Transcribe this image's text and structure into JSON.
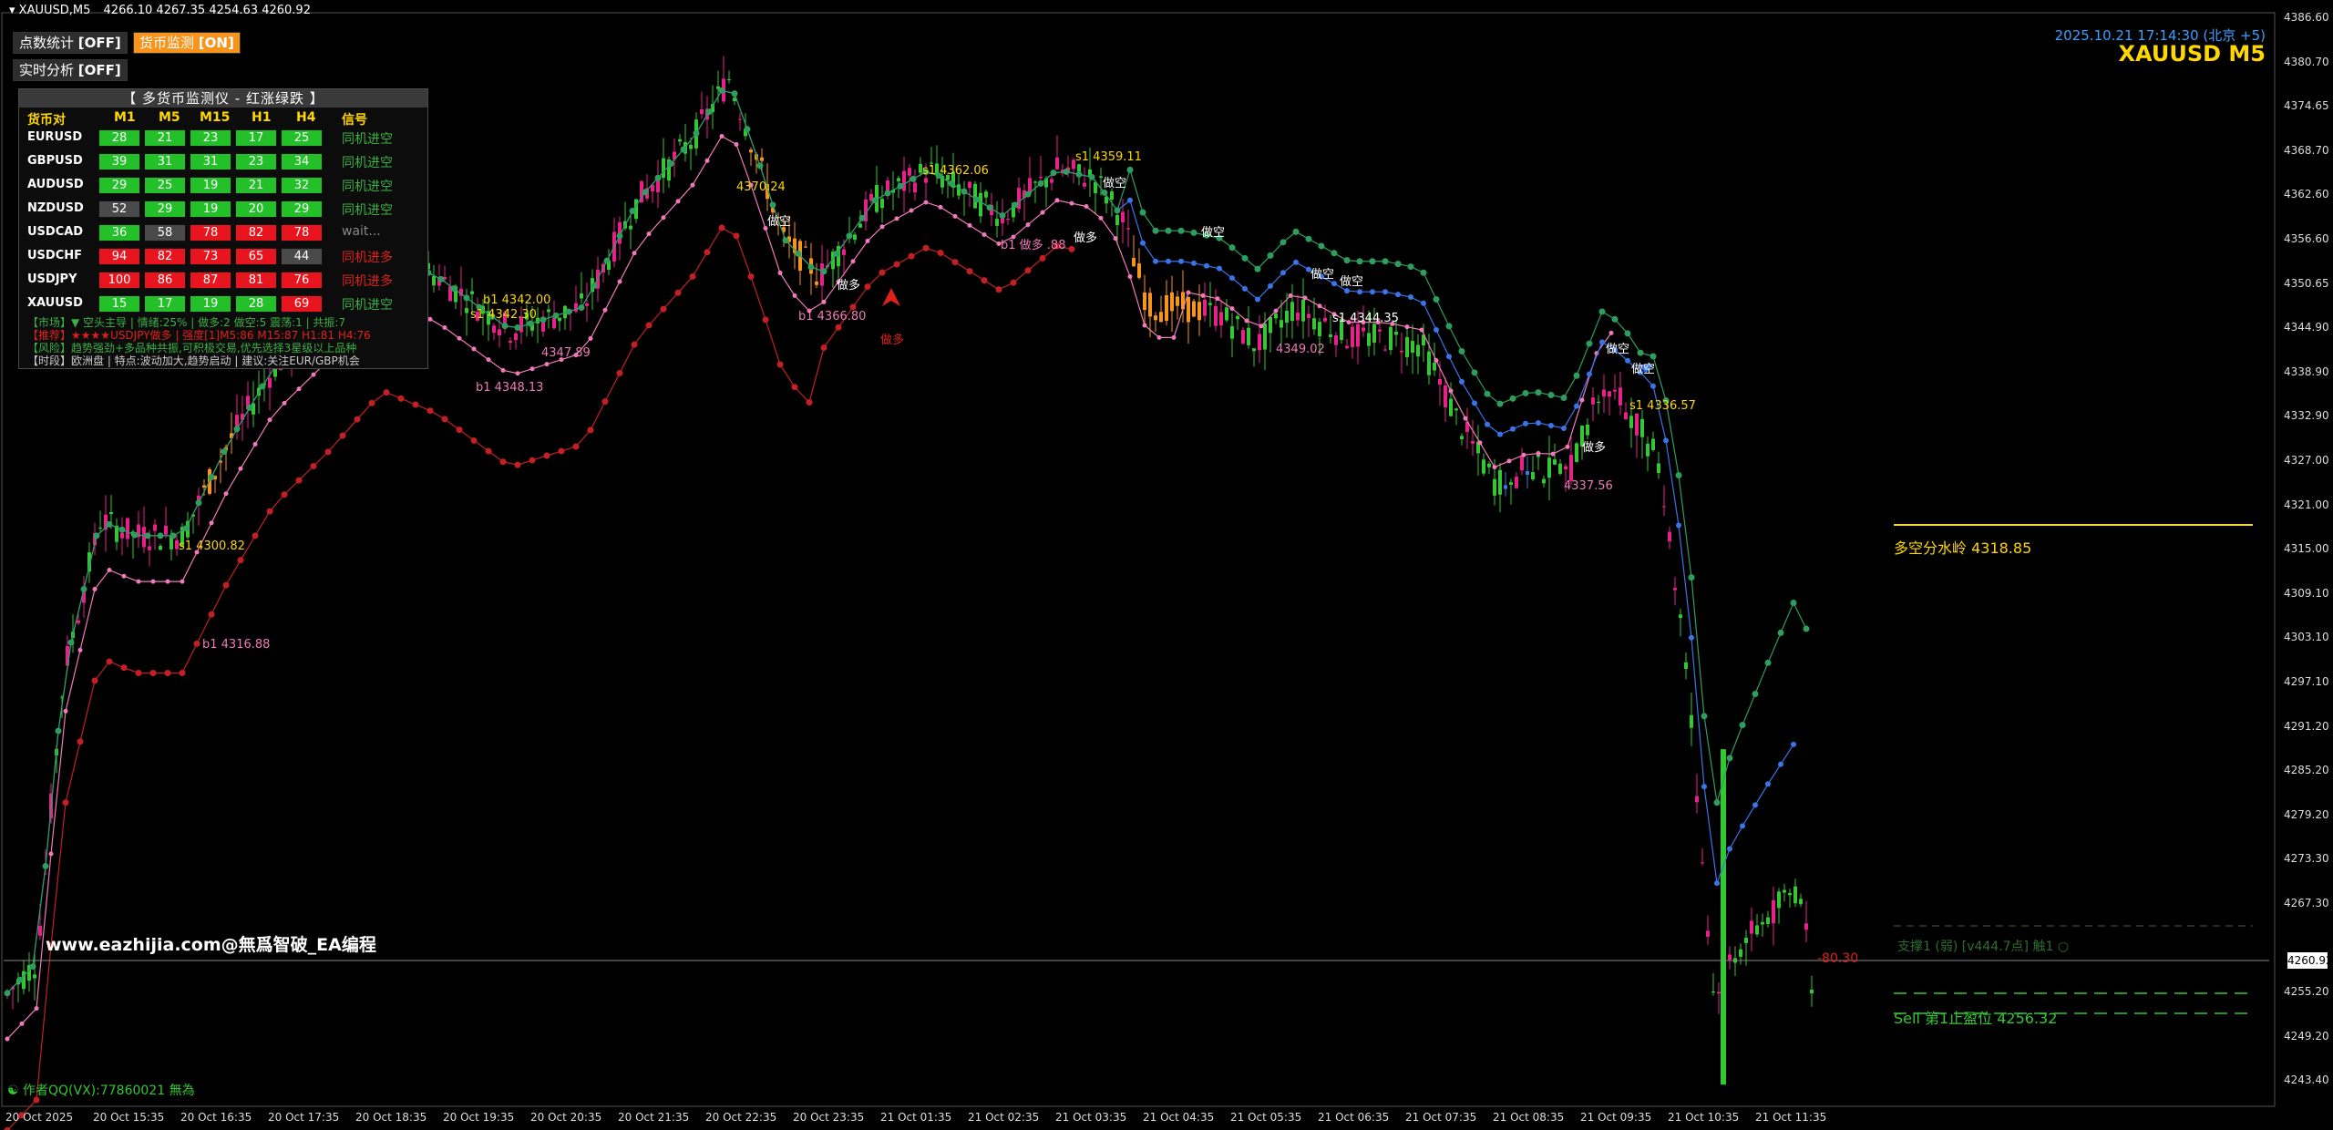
{
  "window": {
    "title": "XAUUSD,M5",
    "ohlc": "4266.10 4267.35 4254.63 4260.92"
  },
  "buttons": {
    "points_stat": {
      "label": "点数统计",
      "state": "[OFF]"
    },
    "currency_monitor": {
      "label": "货币监测",
      "state": "[ON]"
    },
    "realtime": {
      "label": "实时分析",
      "state": "[OFF]"
    }
  },
  "monitor": {
    "title": "【 多货币监测仪 - 红涨绿跌 】",
    "headers": [
      "货币对",
      "M1",
      "M5",
      "M15",
      "H1",
      "H4",
      "信号"
    ],
    "rows": [
      {
        "pair": "EURUSD",
        "values": [
          "28",
          "21",
          "23",
          "17",
          "25"
        ],
        "colors": [
          "g",
          "g",
          "g",
          "g",
          "g"
        ],
        "signal": "同机进空",
        "signal_color": "#3cb043"
      },
      {
        "pair": "GBPUSD",
        "values": [
          "39",
          "31",
          "31",
          "23",
          "34"
        ],
        "colors": [
          "g",
          "g",
          "g",
          "g",
          "g"
        ],
        "signal": "同机进空",
        "signal_color": "#3cb043"
      },
      {
        "pair": "AUDUSD",
        "values": [
          "29",
          "25",
          "19",
          "21",
          "32"
        ],
        "colors": [
          "g",
          "g",
          "g",
          "g",
          "g"
        ],
        "signal": "同机进空",
        "signal_color": "#3cb043"
      },
      {
        "pair": "NZDUSD",
        "values": [
          "52",
          "29",
          "19",
          "20",
          "29"
        ],
        "colors": [
          "n",
          "g",
          "g",
          "g",
          "g"
        ],
        "signal": "同机进空",
        "signal_color": "#3cb043"
      },
      {
        "pair": "USDCAD",
        "values": [
          "36",
          "58",
          "78",
          "82",
          "78"
        ],
        "colors": [
          "g",
          "n",
          "r",
          "r",
          "r"
        ],
        "signal": "wait...",
        "signal_color": "#888888"
      },
      {
        "pair": "USDCHF",
        "values": [
          "94",
          "82",
          "73",
          "65",
          "44"
        ],
        "colors": [
          "r",
          "r",
          "r",
          "r",
          "n"
        ],
        "signal": "同机进多",
        "signal_color": "#e0201c"
      },
      {
        "pair": "USDJPY",
        "values": [
          "100",
          "86",
          "87",
          "81",
          "76"
        ],
        "colors": [
          "r",
          "r",
          "r",
          "r",
          "r"
        ],
        "signal": "同机进多",
        "signal_color": "#e0201c"
      },
      {
        "pair": "XAUUSD",
        "values": [
          "15",
          "17",
          "19",
          "28",
          "69"
        ],
        "colors": [
          "g",
          "g",
          "g",
          "g",
          "r"
        ],
        "signal": "同机进空",
        "signal_color": "#3cb043"
      }
    ],
    "notes": [
      {
        "text": "【市场】▼ 空头主导 | 情绪:25% | 做多:2 做空:5 震荡:1 | 共振:7",
        "color": "#3cb043"
      },
      {
        "text": "【推荐】★★★★USDJPY做多 | 强度[1]M5:86 M15:87 H1:81 H4:76",
        "color": "#e0201c"
      },
      {
        "text": "【风险】趋势强劲+多品种共振,可积极交易,优先选择3星级以上品种",
        "color": "#3cb043"
      },
      {
        "text": "【时段】欧洲盘 | 特点:波动加大,趋势启动 | 建议:关注EUR/GBP机会",
        "color": "#cccccc"
      }
    ]
  },
  "top_right": {
    "datetime": "2025.10.21 17:14:30 (北京 +5)",
    "symbol_tf": "XAUUSD M5"
  },
  "colors": {
    "gold": "#ffd700",
    "bull": "#e8208a",
    "bear": "#33c733",
    "accent": "#f7941d",
    "blue": "#3a74e8",
    "pink": "#f07ab8",
    "red_ma": "#c41f24"
  },
  "price_axis": {
    "labels": [
      "4386.60",
      "4380.70",
      "4374.65",
      "4368.70",
      "4362.60",
      "4356.60",
      "4350.65",
      "4344.90",
      "4338.90",
      "4332.90",
      "4327.00",
      "4321.00",
      "4315.00",
      "4309.10",
      "4303.10",
      "4297.10",
      "4291.20",
      "4285.20",
      "4279.20",
      "4273.30",
      "4267.30",
      "4260.92",
      "4255.20",
      "4249.20",
      "4243.40"
    ],
    "current": "4260.92"
  },
  "time_axis": {
    "labels": [
      "20 Oct 2025",
      "20 Oct 15:35",
      "20 Oct 16:35",
      "20 Oct 17:35",
      "20 Oct 18:35",
      "20 Oct 19:35",
      "20 Oct 20:35",
      "20 Oct 21:35",
      "20 Oct 22:35",
      "20 Oct 23:35",
      "21 Oct 01:35",
      "21 Oct 02:35",
      "21 Oct 03:35",
      "21 Oct 04:35",
      "21 Oct 05:35",
      "21 Oct 06:35",
      "21 Oct 07:35",
      "21 Oct 08:35",
      "21 Oct 09:35",
      "21 Oct 10:35",
      "21 Oct 11:35"
    ]
  },
  "levels": {
    "watershed": "多空分水岭 4318.85",
    "support": "支撑1 (弱) [v444.7点] 触1 ○",
    "sell_tp": "Sell 第1止盈位 4256.32",
    "delta": "-80.30"
  },
  "chart_labels": [
    {
      "text": "s1 4300.82",
      "color": "#ffd700"
    },
    {
      "text": "b1 4316.88",
      "color": "#f07ab8"
    },
    {
      "text": "b1 4342.00",
      "color": "#ffd700"
    },
    {
      "text": "s1 4342.30",
      "color": "#ffd700"
    },
    {
      "text": "4347.89",
      "color": "#f07ab8"
    },
    {
      "text": "b1 4348.13",
      "color": "#f07ab8"
    },
    {
      "text": "4370.24",
      "color": "#ffd700"
    },
    {
      "text": "做空",
      "color": "#ffffff"
    },
    {
      "text": "做多",
      "color": "#ffffff"
    },
    {
      "text": "b1 4366.80",
      "color": "#f07ab8"
    },
    {
      "text": "做多",
      "color": "#e0201c"
    },
    {
      "text": "s1 4362.06",
      "color": "#ffd700"
    },
    {
      "text": "b1 做多 .88",
      "color": "#f07ab8"
    },
    {
      "text": "做多",
      "color": "#ffffff"
    },
    {
      "text": "s1 4359.11",
      "color": "#ffd700"
    },
    {
      "text": "做空",
      "color": "#ffffff"
    },
    {
      "text": "做空",
      "color": "#ffffff"
    },
    {
      "text": "做空",
      "color": "#ffffff"
    },
    {
      "text": "做空",
      "color": "#ffffff"
    },
    {
      "text": "s1 4344.35",
      "color": "#ffffff"
    },
    {
      "text": "4349.02",
      "color": "#f07ab8"
    },
    {
      "text": "做空",
      "color": "#ffffff"
    },
    {
      "text": "做空",
      "color": "#ffffff"
    },
    {
      "text": "s1 4336.57",
      "color": "#ffd700"
    },
    {
      "text": "做多",
      "color": "#ffffff"
    },
    {
      "text": "4337.56",
      "color": "#f07ab8"
    }
  ],
  "watermark": "www.eazhijia.com@無爲智破_EA编程",
  "author": "作者QQ(VX):77860021 無為"
}
